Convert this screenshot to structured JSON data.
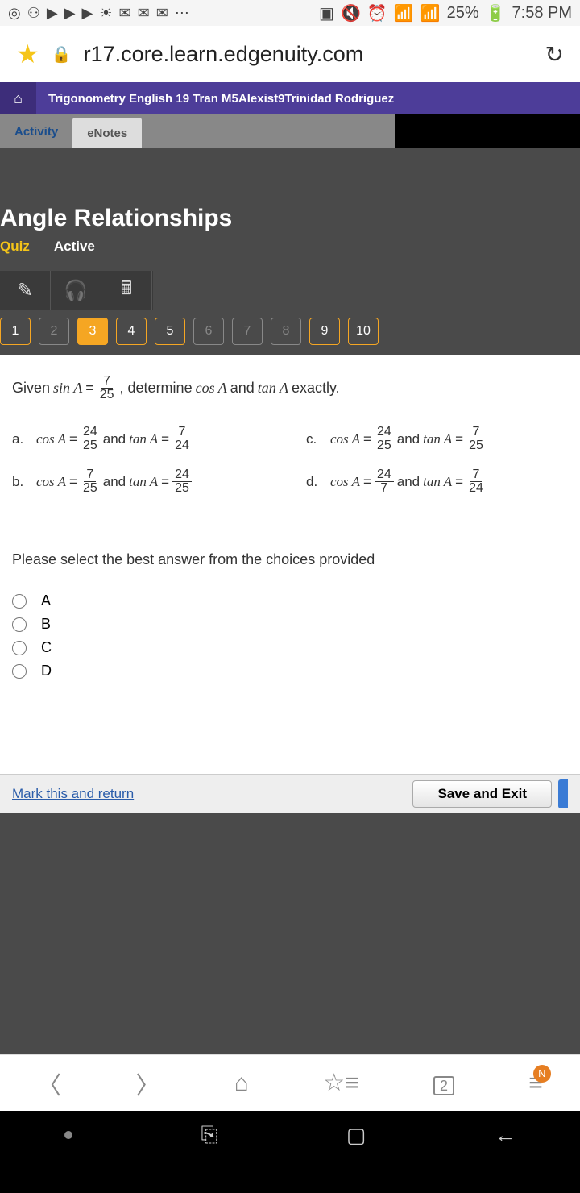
{
  "status": {
    "battery": "25%",
    "time": "7:58 PM"
  },
  "browser": {
    "url": "r17.core.learn.edgenuity.com"
  },
  "course": {
    "title": "Trigonometry English 19 Tran M5Alexist9Trinidad Rodriguez"
  },
  "tabs": {
    "activity": "Activity",
    "enotes": "eNotes"
  },
  "page": {
    "title": "Angle Relationships",
    "quiz": "Quiz",
    "active": "Active"
  },
  "questions": [
    "1",
    "2",
    "3",
    "4",
    "5",
    "6",
    "7",
    "8",
    "9",
    "10"
  ],
  "question": {
    "given_prefix": "Given",
    "sin_label": "sin A",
    "equals": "=",
    "sin_num": "7",
    "sin_den": "25",
    "determine": ", determine",
    "cos_label": "cos A",
    "and": "and",
    "tan_label": "tan A",
    "exactly": "exactly.",
    "options": {
      "a": {
        "label": "a.",
        "cos_num": "24",
        "cos_den": "25",
        "tan_num": "7",
        "tan_den": "24"
      },
      "b": {
        "label": "b.",
        "cos_num": "7",
        "cos_den": "25",
        "tan_num": "24",
        "tan_den": "25"
      },
      "c": {
        "label": "c.",
        "cos_num": "24",
        "cos_den": "25",
        "tan_num": "7",
        "tan_den": "25"
      },
      "d": {
        "label": "d.",
        "cos_num": "24",
        "cos_den": "7",
        "tan_num": "7",
        "tan_den": "24"
      }
    },
    "prompt": "Please select the best answer from the choices provided",
    "choices": [
      "A",
      "B",
      "C",
      "D"
    ]
  },
  "footer": {
    "mark": "Mark this and return",
    "save": "Save and Exit"
  },
  "nav": {
    "tab_count": "2",
    "badge": "N"
  }
}
